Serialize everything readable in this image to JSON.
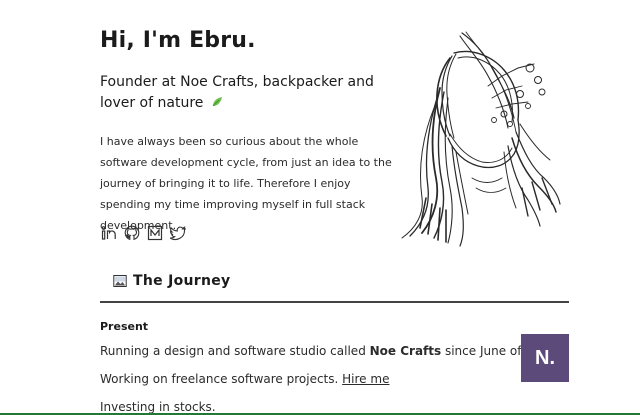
{
  "hero": {
    "title": "Hi, I'm Ebru.",
    "tagline": "Founder at Noe Crafts, backpacker and lover of nature",
    "tagline_icon": "leaf-icon",
    "bio": "I have always been so curious about the whole software development cycle, from just an idea to the journey of bringing it to life. Therefore I enjoy spending my time improving myself in full stack development."
  },
  "socials": [
    {
      "name": "linkedin-icon"
    },
    {
      "name": "github-icon"
    },
    {
      "name": "medium-icon"
    },
    {
      "name": "twitter-icon"
    }
  ],
  "journey": {
    "section_icon": "picture-icon",
    "section_title": "The Journey",
    "period": "Present",
    "entry1_prefix": "Running a design and software studio called ",
    "entry1_name": "Noe Crafts",
    "entry1_suffix": " since June of 2020.",
    "entry2_prefix": "Working on freelance software projects. ",
    "entry2_link": "Hire me",
    "entry3": "Investing in stocks.",
    "logo_letter": "N."
  },
  "colors": {
    "logo_bg": "#5c4b7a",
    "rule": "#444444",
    "bottom_accent": "#1f7a3a"
  }
}
